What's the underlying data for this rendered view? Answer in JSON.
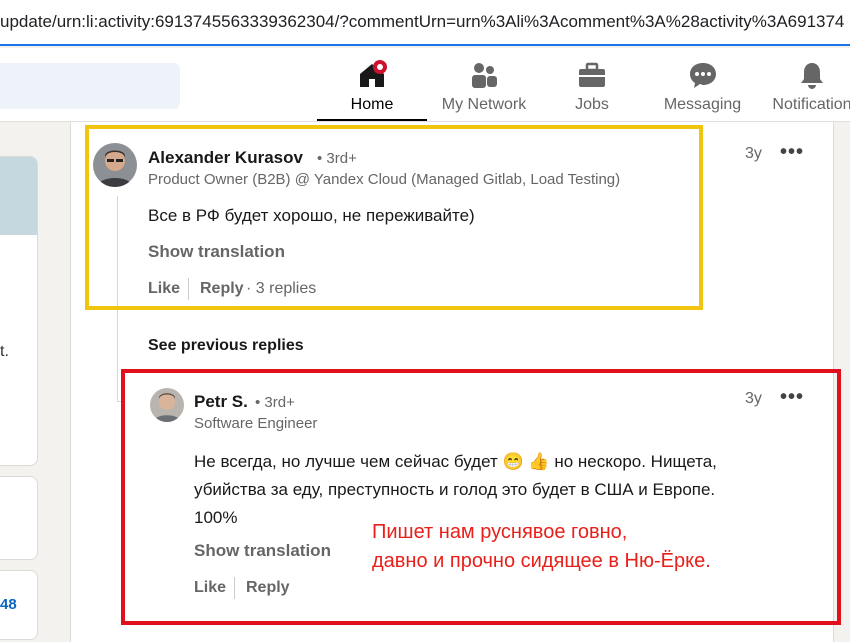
{
  "browser": {
    "url": "update/urn:li:activity:6913745563339362304/?commentUrn=urn%3Ali%3Acomment%3A%28activity%3A691374"
  },
  "nav": {
    "items": [
      {
        "label": "Home",
        "icon": "home-icon"
      },
      {
        "label": "My Network",
        "icon": "network-icon"
      },
      {
        "label": "Jobs",
        "icon": "briefcase-icon"
      },
      {
        "label": "Messaging",
        "icon": "message-icon"
      },
      {
        "label": "Notification",
        "icon": "bell-icon"
      }
    ]
  },
  "left": {
    "fragment": "t.",
    "number": "48"
  },
  "comment1": {
    "author": "Alexander Kurasov",
    "degree": "• 3rd+",
    "headline": "Product Owner (B2B) @ Yandex Cloud (Managed Gitlab, Load Testing)",
    "time": "3y",
    "text": "Все в РФ будет хорошо, не переживайте)",
    "show_translation": "Show translation",
    "like": "Like",
    "reply": "Reply",
    "replies": "· 3 replies"
  },
  "see_previous": "See previous replies",
  "comment2": {
    "author": "Petr S.",
    "degree": "• 3rd+",
    "headline": "Software Engineer",
    "time": "3y",
    "text_line1_a": "Не всегда, но лучше чем сейчас будет",
    "emoji1": "😁",
    "emoji2": "👍",
    "text_line1_b": "но нескоро. Нищета,",
    "text_line2": "убийства за еду, преступность и голод это будет в США и Европе.",
    "text_line3": "100%",
    "show_translation": "Show translation",
    "like": "Like",
    "reply": "Reply"
  },
  "annotation": {
    "line1": "Пишет нам руснявое говно,",
    "line2": "давно и прочно сидящее в Ню-Ёрке."
  },
  "colors": {
    "highlight_yellow": "#f1c40f",
    "highlight_red": "#e0111c",
    "annotation_red": "#e8201a",
    "link_blue": "#0a66c2",
    "notification_badge": "#cb112d"
  }
}
